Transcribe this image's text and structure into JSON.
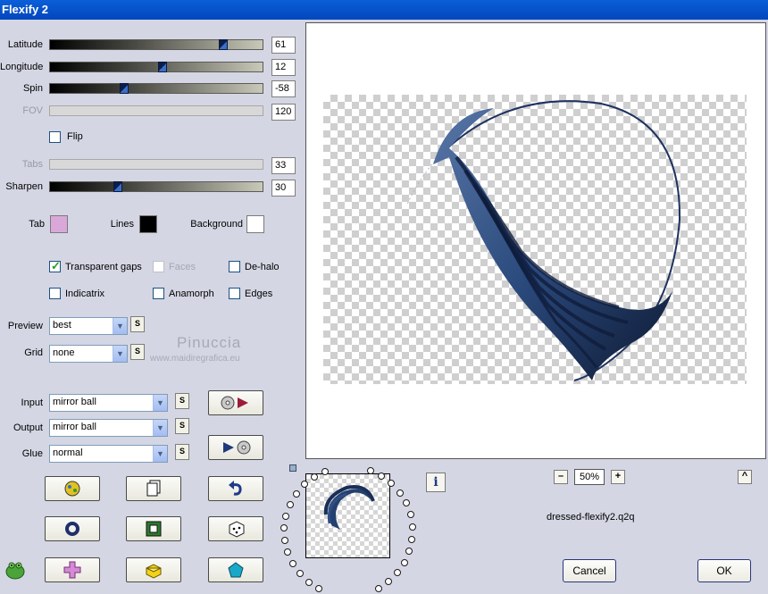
{
  "window": {
    "title": "Flexify 2"
  },
  "sliders": [
    {
      "key": "latitude",
      "label": "Latitude",
      "value": "61",
      "fraction": 0.83,
      "enabled": true
    },
    {
      "key": "longitude",
      "label": "Longitude",
      "value": "12",
      "fraction": 0.53,
      "enabled": true
    },
    {
      "key": "spin",
      "label": "Spin",
      "value": "-58",
      "fraction": 0.34,
      "enabled": true
    },
    {
      "key": "fov",
      "label": "FOV",
      "value": "120",
      "fraction": null,
      "enabled": false
    },
    {
      "key": "tabs",
      "label": "Tabs",
      "value": "33",
      "fraction": null,
      "enabled": false
    },
    {
      "key": "sharpen",
      "label": "Sharpen",
      "value": "30",
      "fraction": 0.31,
      "enabled": true
    }
  ],
  "flip": {
    "label": "Flip",
    "checked": false
  },
  "colors": {
    "tab": {
      "label": "Tab",
      "value": "#d9a8d9"
    },
    "lines": {
      "label": "Lines",
      "value": "#000000"
    },
    "background": {
      "label": "Background",
      "value": "#ffffff"
    }
  },
  "options": {
    "transparent_gaps": {
      "label": "Transparent gaps",
      "checked": true,
      "enabled": true
    },
    "faces": {
      "label": "Faces",
      "checked": false,
      "enabled": false
    },
    "de_halo": {
      "label": "De-halo",
      "checked": false,
      "enabled": true
    },
    "indicatrix": {
      "label": "Indicatrix",
      "checked": false,
      "enabled": true
    },
    "anamorph": {
      "label": "Anamorph",
      "checked": false,
      "enabled": true
    },
    "edges": {
      "label": "Edges",
      "checked": false,
      "enabled": true
    }
  },
  "preview_select": {
    "label": "Preview",
    "value": "best"
  },
  "grid_select": {
    "label": "Grid",
    "value": "none"
  },
  "input_select": {
    "label": "Input",
    "value": "mirror ball"
  },
  "output_select": {
    "label": "Output",
    "value": "mirror ball"
  },
  "glue_select": {
    "label": "Glue",
    "value": "normal"
  },
  "s_button_label": "S",
  "watermark": {
    "name": "Pinuccia",
    "site": "www.maidiregrafica.eu"
  },
  "zoom": {
    "value": "50%",
    "minus": "–",
    "plus": "+"
  },
  "preset_name": "dressed-flexify2.q2q",
  "info_label": "i",
  "collapse_label": "^",
  "buttons": {
    "cancel": "Cancel",
    "ok": "OK"
  },
  "accent": "#34507f"
}
